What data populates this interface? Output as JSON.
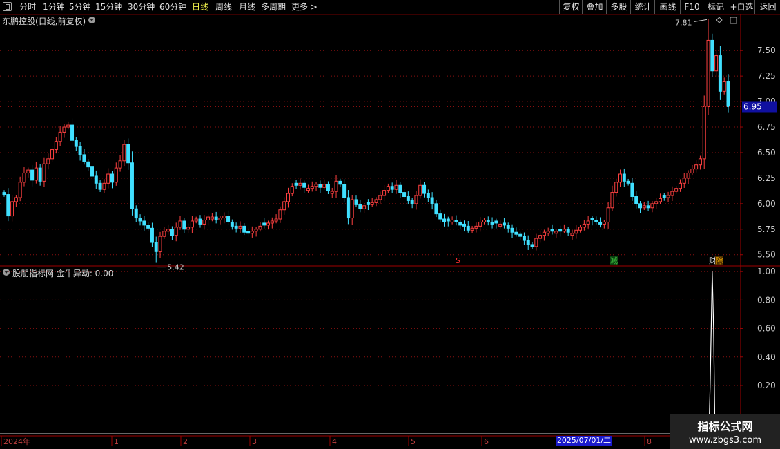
{
  "toolbar": {
    "periods": [
      "分时",
      "1分钟",
      "5分钟",
      "15分钟",
      "30分钟",
      "60分钟",
      "日线",
      "周线",
      "月线",
      "多周期",
      "更多 >"
    ],
    "active": "日线",
    "right_buttons": [
      "复权",
      "叠加",
      "多股",
      "统计",
      "画线",
      "F10",
      "标记",
      "+自选",
      "返回"
    ]
  },
  "main_panel": {
    "title": "东鹏控股(日线,前复权)",
    "current_price_label": "6.95",
    "max_label": "7.81",
    "min_label": "5.42",
    "markers": [
      {
        "text": "S",
        "color": "#ff3030"
      },
      {
        "text": "减",
        "color": "#40c040"
      },
      {
        "text": "财",
        "color": "#e0e0e0"
      },
      {
        "text": "除",
        "color": "#e0a000"
      }
    ]
  },
  "indicator_panel": {
    "title": "股朋指标网 金牛异动: 0.00"
  },
  "x_axis": {
    "labels": [
      "2024年",
      "1",
      "2",
      "3",
      "4",
      "5",
      "6",
      "2025/07/01/二",
      "8"
    ]
  },
  "watermark": {
    "line1": "指标公式网",
    "line2": "www.zbgs3.com"
  },
  "colors": {
    "up": "#ff4040",
    "down": "#40e0ff",
    "grid": "#8a1010",
    "axis": "#a00000",
    "text": "#c8c8c8"
  },
  "chart_data": [
    {
      "type": "candlestick",
      "title": "东鹏控股(日线,前复权)",
      "y_ticks": [
        7.5,
        7.25,
        7.0,
        6.75,
        6.5,
        6.25,
        6.0,
        5.75,
        5.5
      ],
      "ylim": [
        5.39,
        7.86
      ],
      "grid": true,
      "close": [
        6.09,
        5.88,
        6.02,
        6.06,
        6.21,
        6.3,
        6.33,
        6.23,
        6.35,
        6.22,
        6.39,
        6.44,
        6.53,
        6.61,
        6.7,
        6.75,
        6.77,
        6.62,
        6.56,
        6.48,
        6.41,
        6.36,
        6.27,
        6.2,
        6.14,
        6.2,
        6.29,
        6.21,
        6.35,
        6.42,
        6.58,
        6.4,
        5.95,
        5.86,
        5.83,
        5.79,
        5.76,
        5.62,
        5.53,
        5.68,
        5.73,
        5.75,
        5.69,
        5.77,
        5.83,
        5.75,
        5.77,
        5.83,
        5.85,
        5.8,
        5.84,
        5.87,
        5.87,
        5.84,
        5.86,
        5.88,
        5.82,
        5.78,
        5.76,
        5.78,
        5.72,
        5.71,
        5.73,
        5.75,
        5.78,
        5.79,
        5.81,
        5.83,
        5.85,
        5.94,
        6.02,
        6.1,
        6.17,
        6.18,
        6.2,
        6.16,
        6.15,
        6.17,
        6.19,
        6.16,
        6.19,
        6.13,
        6.12,
        6.22,
        6.19,
        6.06,
        5.86,
        6.04,
        5.99,
        5.95,
        5.98,
        5.99,
        6.01,
        6.04,
        6.08,
        6.13,
        6.17,
        6.14,
        6.18,
        6.11,
        6.07,
        6.03,
        6.0,
        6.08,
        6.18,
        6.1,
        6.06,
        6.0,
        5.9,
        5.85,
        5.82,
        5.83,
        5.84,
        5.82,
        5.79,
        5.78,
        5.74,
        5.76,
        5.78,
        5.82,
        5.84,
        5.82,
        5.8,
        5.81,
        5.8,
        5.79,
        5.76,
        5.72,
        5.7,
        5.68,
        5.64,
        5.6,
        5.58,
        5.66,
        5.69,
        5.72,
        5.73,
        5.73,
        5.73,
        5.73,
        5.75,
        5.72,
        5.71,
        5.74,
        5.77,
        5.8,
        5.83,
        5.84,
        5.82,
        5.8,
        5.82,
        5.96,
        6.11,
        6.21,
        6.29,
        6.22,
        6.2,
        6.07,
        6.0,
        5.96,
        5.98,
        5.96,
        6.0,
        6.02,
        6.05,
        6.06,
        6.08,
        6.12,
        6.15,
        6.2,
        6.25,
        6.3,
        6.34,
        6.38,
        6.44,
        6.95,
        7.6,
        7.3,
        7.45,
        7.1,
        7.2,
        6.95
      ]
    },
    {
      "type": "line",
      "title": "股朋指标网 金牛异动: 0.00",
      "y_ticks": [
        1.0,
        0.8,
        0.6,
        0.4,
        0.2
      ],
      "ylim": [
        -0.14,
        1.03
      ],
      "series": [
        {
          "name": "金牛异动",
          "spike": {
            "index": 177,
            "value": 1.0
          }
        }
      ]
    }
  ]
}
